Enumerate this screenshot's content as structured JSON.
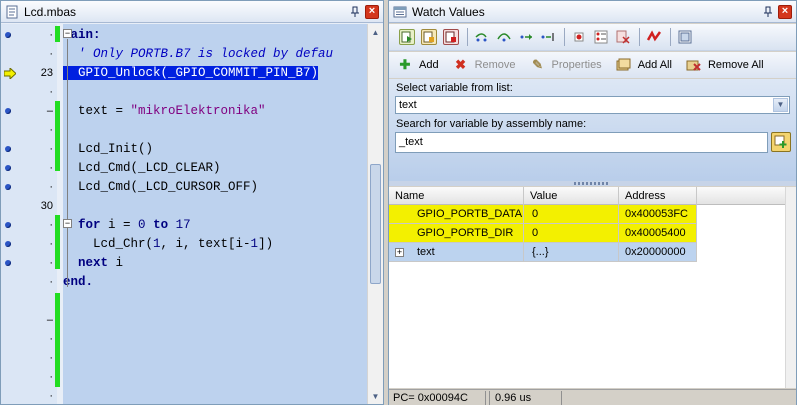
{
  "editor": {
    "title": "Lcd.mbas",
    "lines": [
      {
        "gutter": "dot",
        "num": "",
        "marker": "·",
        "segments": [
          {
            "t": "main:",
            "c": "kw"
          }
        ]
      },
      {
        "gutter": "",
        "num": "",
        "marker": "·",
        "segments": [
          {
            "t": "  ' Only PORTB.B7 is locked by defau",
            "c": "cmt"
          }
        ]
      },
      {
        "gutter": "exec",
        "num": "23",
        "marker": "",
        "segments": [
          {
            "t": "  GPIO_Unlock(_GPIO_COMMIT_PIN_B7)",
            "c": "hl"
          }
        ]
      },
      {
        "gutter": "",
        "num": "",
        "marker": "·",
        "segments": []
      },
      {
        "gutter": "dot",
        "num": "",
        "marker": "–",
        "segments": [
          {
            "t": "  text = ",
            "c": "plain"
          },
          {
            "t": "\"mikroElektronika\"",
            "c": "str"
          }
        ]
      },
      {
        "gutter": "",
        "num": "",
        "marker": "·",
        "segments": []
      },
      {
        "gutter": "dot",
        "num": "",
        "marker": "·",
        "segments": [
          {
            "t": "  Lcd_Init()",
            "c": "plain"
          }
        ]
      },
      {
        "gutter": "dot",
        "num": "",
        "marker": "·",
        "segments": [
          {
            "t": "  Lcd_Cmd(_LCD_CLEAR)",
            "c": "plain"
          }
        ]
      },
      {
        "gutter": "dot",
        "num": "",
        "marker": "·",
        "segments": [
          {
            "t": "  Lcd_Cmd(_LCD_CURSOR_OFF)",
            "c": "plain"
          }
        ]
      },
      {
        "gutter": "",
        "num": "30",
        "marker": "",
        "segments": []
      },
      {
        "gutter": "dot",
        "num": "",
        "marker": "·",
        "segments": [
          {
            "t": "  for",
            "c": "kw"
          },
          {
            "t": " i = ",
            "c": "plain"
          },
          {
            "t": "0",
            "c": "num"
          },
          {
            "t": " ",
            "c": "plain"
          },
          {
            "t": "to",
            "c": "kw"
          },
          {
            "t": " ",
            "c": "plain"
          },
          {
            "t": "17",
            "c": "num"
          }
        ]
      },
      {
        "gutter": "dot",
        "num": "",
        "marker": "·",
        "segments": [
          {
            "t": "    Lcd_Chr(",
            "c": "plain"
          },
          {
            "t": "1",
            "c": "num"
          },
          {
            "t": ", i, text[i-",
            "c": "plain"
          },
          {
            "t": "1",
            "c": "num"
          },
          {
            "t": "])",
            "c": "plain"
          }
        ]
      },
      {
        "gutter": "dot",
        "num": "",
        "marker": "·",
        "segments": [
          {
            "t": "  next",
            "c": "kw"
          },
          {
            "t": " i",
            "c": "plain"
          }
        ]
      },
      {
        "gutter": "",
        "num": "",
        "marker": "·",
        "segments": [
          {
            "t": "end.",
            "c": "kw"
          }
        ]
      },
      {
        "gutter": "",
        "num": "",
        "marker": "",
        "segments": []
      },
      {
        "gutter": "",
        "num": "",
        "marker": "–",
        "segments": []
      },
      {
        "gutter": "",
        "num": "",
        "marker": "·",
        "segments": []
      },
      {
        "gutter": "",
        "num": "",
        "marker": "·",
        "segments": []
      },
      {
        "gutter": "",
        "num": "",
        "marker": "·",
        "segments": []
      },
      {
        "gutter": "",
        "num": "",
        "marker": "·",
        "segments": []
      }
    ]
  },
  "watch": {
    "title": "Watch Values",
    "toolbar2": {
      "add": "Add",
      "remove": "Remove",
      "properties": "Properties",
      "add_all": "Add All",
      "remove_all": "Remove All"
    },
    "select_label": "Select variable from list:",
    "select_value": "text",
    "search_label": "Search for variable by assembly name:",
    "search_value": "_text",
    "columns": {
      "name": "Name",
      "value": "Value",
      "address": "Address"
    },
    "rows": [
      {
        "name": "GPIO_PORTB_DATA",
        "value": "0",
        "address": "0x400053FC",
        "style": "yellow",
        "expandable": false
      },
      {
        "name": "GPIO_PORTB_DIR",
        "value": "0",
        "address": "0x40005400",
        "style": "yellow",
        "expandable": false
      },
      {
        "name": "text",
        "value": "{...}",
        "address": "0x20000000",
        "style": "blue",
        "expandable": true
      }
    ],
    "status": {
      "pc": "PC= 0x00094C",
      "time": "0.96 us"
    }
  },
  "colors": {
    "highlight": "#0020e0",
    "watch_changed": "#f3f000",
    "code_bg": "#bdd2ee",
    "breakpoint_green": "#22dd22"
  }
}
